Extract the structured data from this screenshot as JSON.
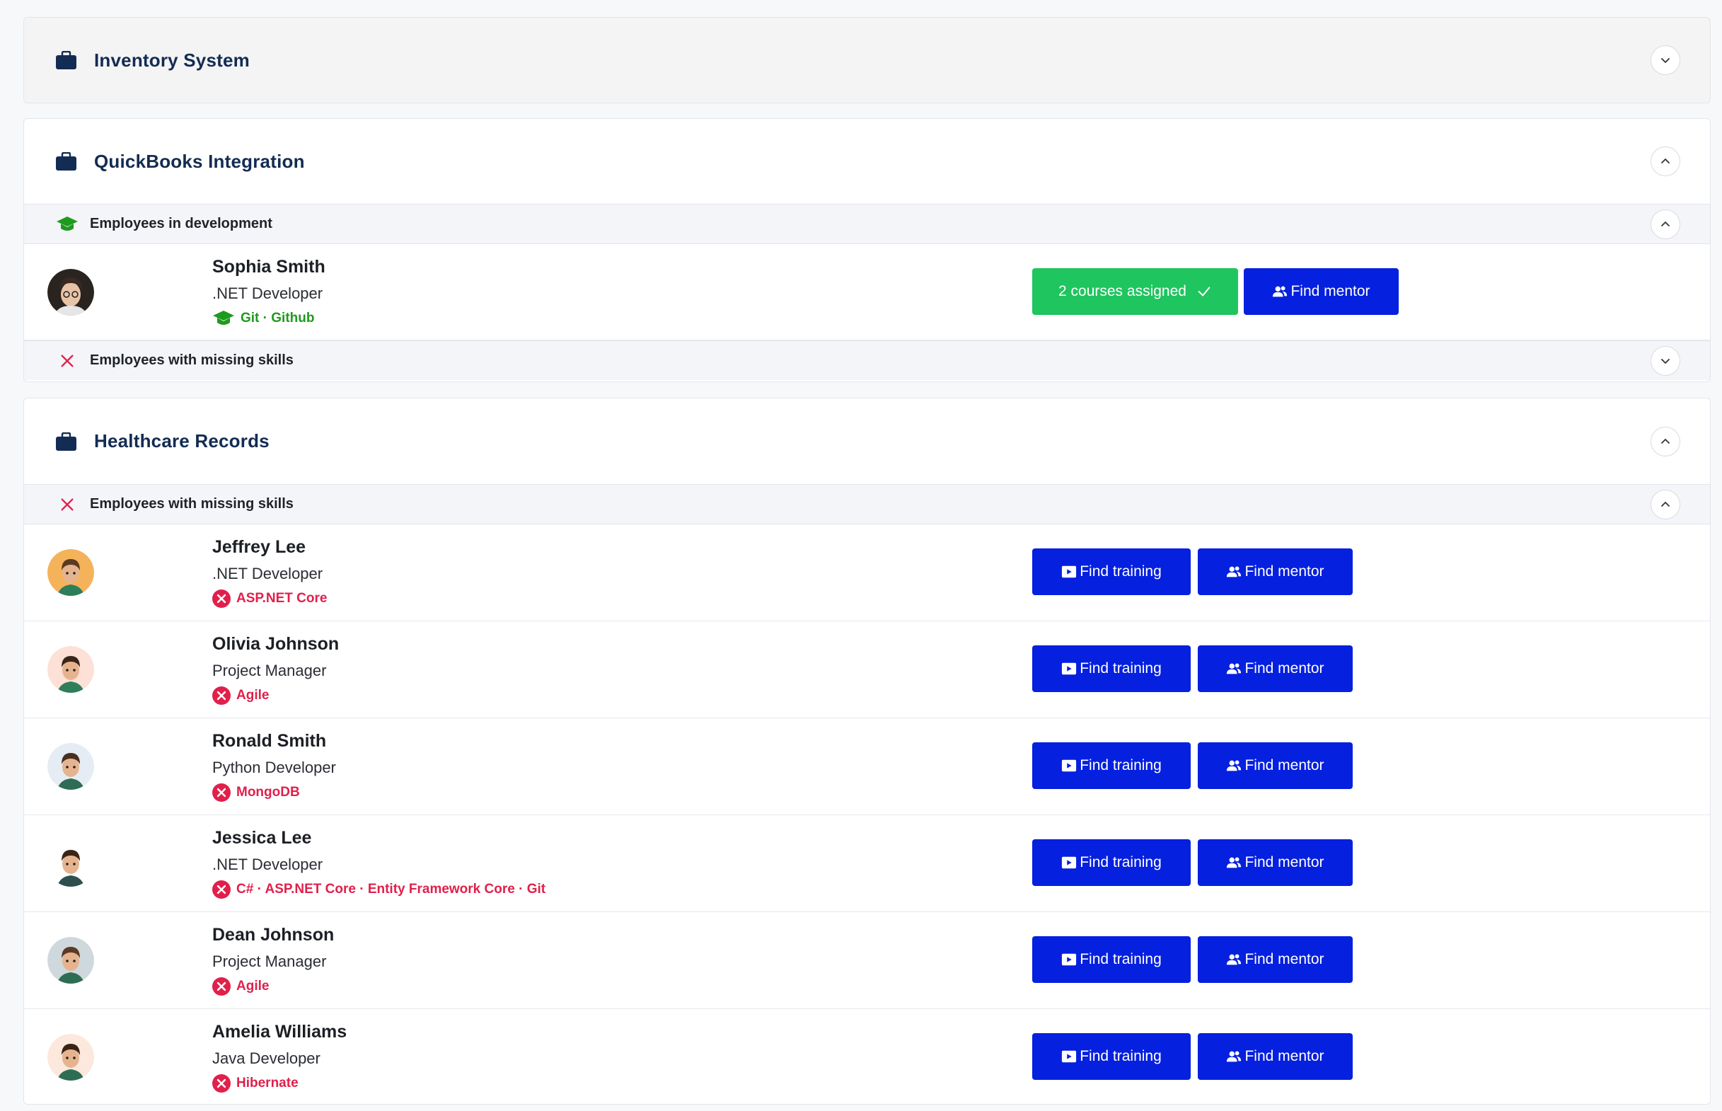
{
  "projects": [
    {
      "title": "Inventory System",
      "expanded": false
    },
    {
      "title": "QuickBooks Integration",
      "expanded": true,
      "sections": {
        "development": {
          "title": "Employees in development"
        },
        "missing": {
          "title": "Employees with missing skills"
        }
      }
    },
    {
      "title": "Healthcare Records",
      "expanded": true,
      "sections": {
        "missing": {
          "title": "Employees with missing skills"
        }
      }
    }
  ],
  "dev_employee": {
    "name": "Sophia Smith",
    "role": ".NET Developer",
    "skills": "Git · Github",
    "courses_label": "2 courses assigned",
    "mentor_label": "Find mentor"
  },
  "missing_employees": [
    {
      "name": "Jeffrey Lee",
      "role": ".NET Developer",
      "skills": "ASP.NET Core"
    },
    {
      "name": "Olivia Johnson",
      "role": "Project Manager",
      "skills": "Agile"
    },
    {
      "name": "Ronald Smith",
      "role": "Python Developer",
      "skills": "MongoDB"
    },
    {
      "name": "Jessica Lee",
      "role": ".NET Developer",
      "skills": "C# · ASP.NET Core · Entity Framework Core · Git"
    },
    {
      "name": "Dean Johnson",
      "role": "Project Manager",
      "skills": "Agile"
    },
    {
      "name": "Amelia Williams",
      "role": "Java Developer",
      "skills": "Hibernate"
    }
  ],
  "buttons": {
    "find_training": "Find training",
    "find_mentor": "Find mentor"
  },
  "colors": {
    "primary": "#0520de",
    "success": "#1fc55e",
    "title": "#132c53",
    "danger": "#e0204b",
    "dev": "#1e9a1e"
  }
}
